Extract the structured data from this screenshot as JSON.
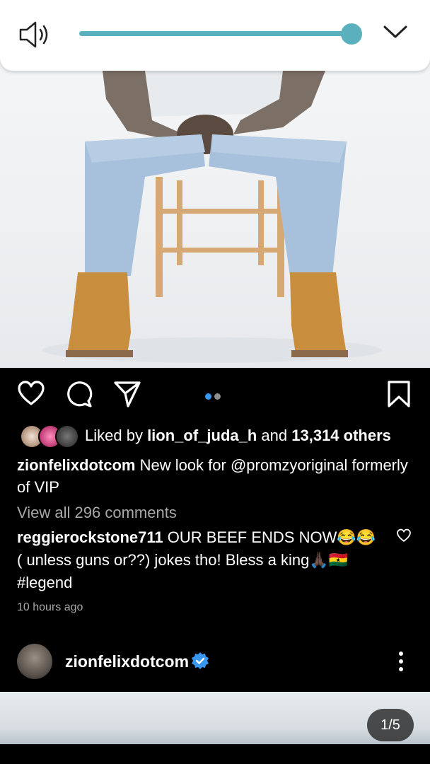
{
  "volume": {
    "level": 0.92,
    "accent": "#5ab0bd"
  },
  "post": {
    "carousel": {
      "total": 2,
      "active": 0,
      "active_color": "#3897f0"
    },
    "likes": {
      "prefix": "Liked by ",
      "user": "lion_of_juda_h",
      "middle": " and ",
      "count": "13,314 others"
    },
    "caption": {
      "user": "zionfelixdotcom",
      "text": " New look for @promzyoriginal formerly of VIP"
    },
    "view_comments": "View all 296 comments",
    "comment": {
      "user": "reggierockstone711",
      "text": " OUR BEEF ENDS NOW😂😂 ( unless guns or??) jokes tho! Bless a king🙏🏿🇬🇭 #legend"
    },
    "timestamp": "10 hours ago"
  },
  "next_post": {
    "username": "zionfelixdotcom",
    "verified_color": "#3897f0",
    "counter": "1/5"
  },
  "icons": [
    "speaker-icon",
    "chevron-down-icon",
    "heart-icon",
    "comment-icon",
    "share-icon",
    "bookmark-icon",
    "verified-icon",
    "more-icon"
  ]
}
